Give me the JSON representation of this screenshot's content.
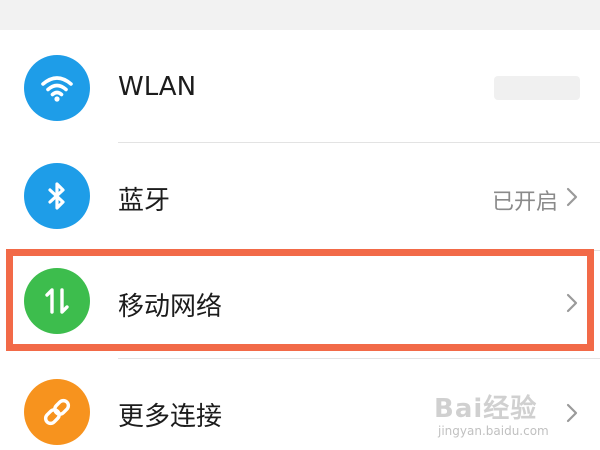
{
  "settings": {
    "items": [
      {
        "label": "WLAN",
        "status": "",
        "icon": "wifi-icon",
        "color": "#1e9de8"
      },
      {
        "label": "蓝牙",
        "status": "已开启",
        "icon": "bluetooth-icon",
        "color": "#1e9de8"
      },
      {
        "label": "移动网络",
        "status": "",
        "icon": "mobile-data-icon",
        "color": "#3dbd4d"
      },
      {
        "label": "更多连接",
        "status": "",
        "icon": "link-icon",
        "color": "#f7931e"
      }
    ]
  },
  "highlight": {
    "color": "#f26a48",
    "target": "移动网络"
  },
  "watermark": {
    "brand": "Bai经验",
    "url": "jingyan.baidu.com"
  }
}
